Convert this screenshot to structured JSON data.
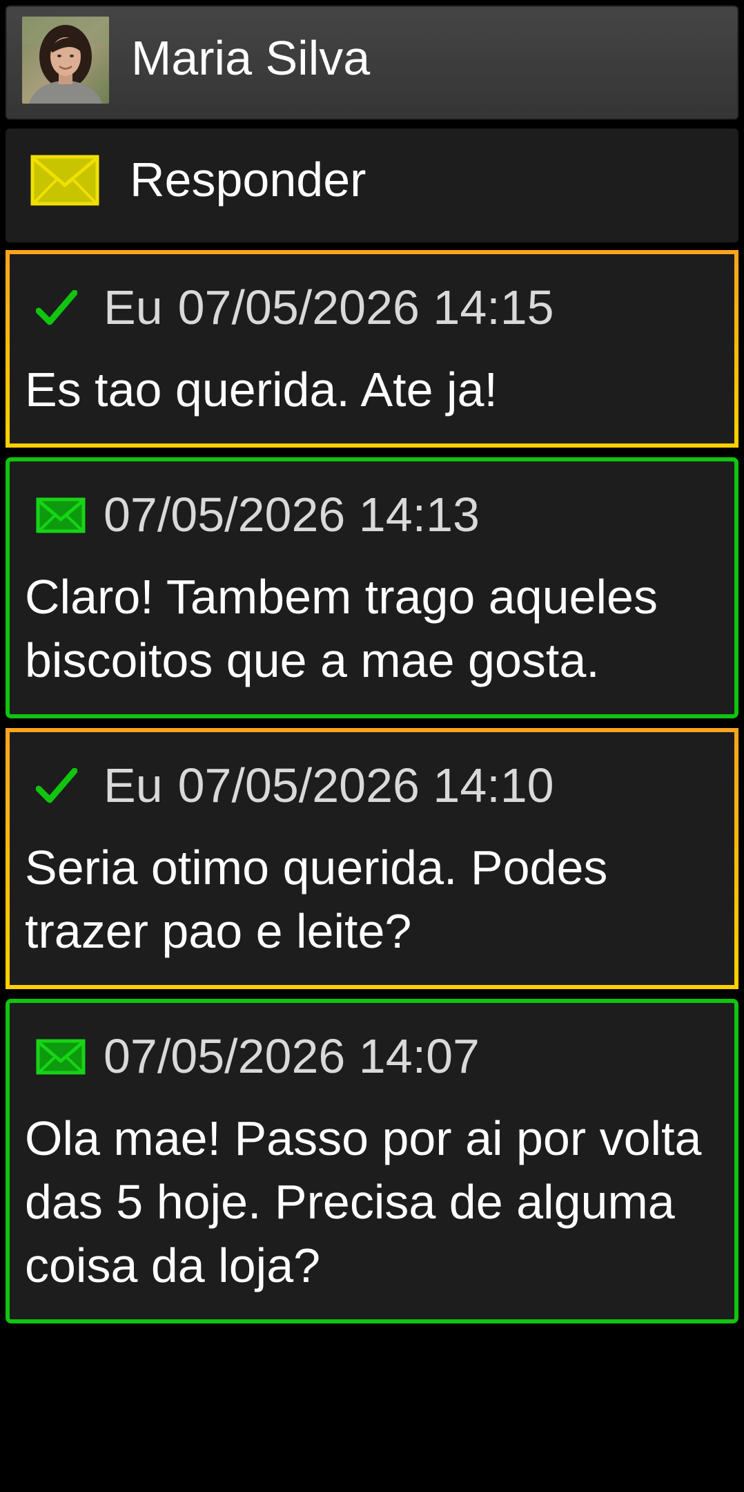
{
  "contact": {
    "name": "Maria Silva"
  },
  "reply": {
    "label": "Responder"
  },
  "colors": {
    "sent_border": "#ffb81c",
    "received_border": "#10c410",
    "card_bg": "#1d1d1d",
    "header_bg": "#404040",
    "envelope_yellow": "#e8d800",
    "envelope_green": "#10c410",
    "check_green": "#10c410"
  },
  "messages": [
    {
      "direction": "sent",
      "icon": "check-icon",
      "sender": "Eu",
      "timestamp": "07/05/2026 14:15",
      "text": "Es tao querida. Ate ja!"
    },
    {
      "direction": "received",
      "icon": "envelope-icon",
      "sender": "",
      "timestamp": "07/05/2026 14:13",
      "text": "Claro! Tambem trago aqueles biscoitos que a mae gosta."
    },
    {
      "direction": "sent",
      "icon": "check-icon",
      "sender": "Eu",
      "timestamp": "07/05/2026 14:10",
      "text": "Seria otimo querida. Podes trazer pao e leite?"
    },
    {
      "direction": "received",
      "icon": "envelope-icon",
      "sender": "",
      "timestamp": "07/05/2026 14:07",
      "text": "Ola mae! Passo por ai por volta das 5 hoje. Precisa de alguma coisa da loja?"
    }
  ]
}
